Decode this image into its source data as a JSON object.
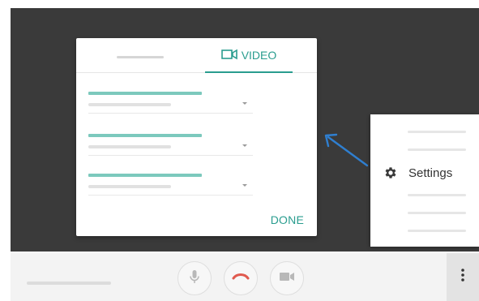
{
  "dialog": {
    "video_tab_label": "VIDEO",
    "video_tab_icon": "videocam-icon",
    "done_label": "DONE",
    "accent_color": "#2a9d8f"
  },
  "settings_menu": {
    "settings_label": "Settings",
    "settings_icon": "gear-icon"
  },
  "controls": {
    "mic_icon": "mic-icon",
    "hangup_icon": "hang-up-icon",
    "camera_icon": "camera-icon",
    "more_icon": "more-vertical-icon",
    "hangup_color": "#e05a4f"
  }
}
